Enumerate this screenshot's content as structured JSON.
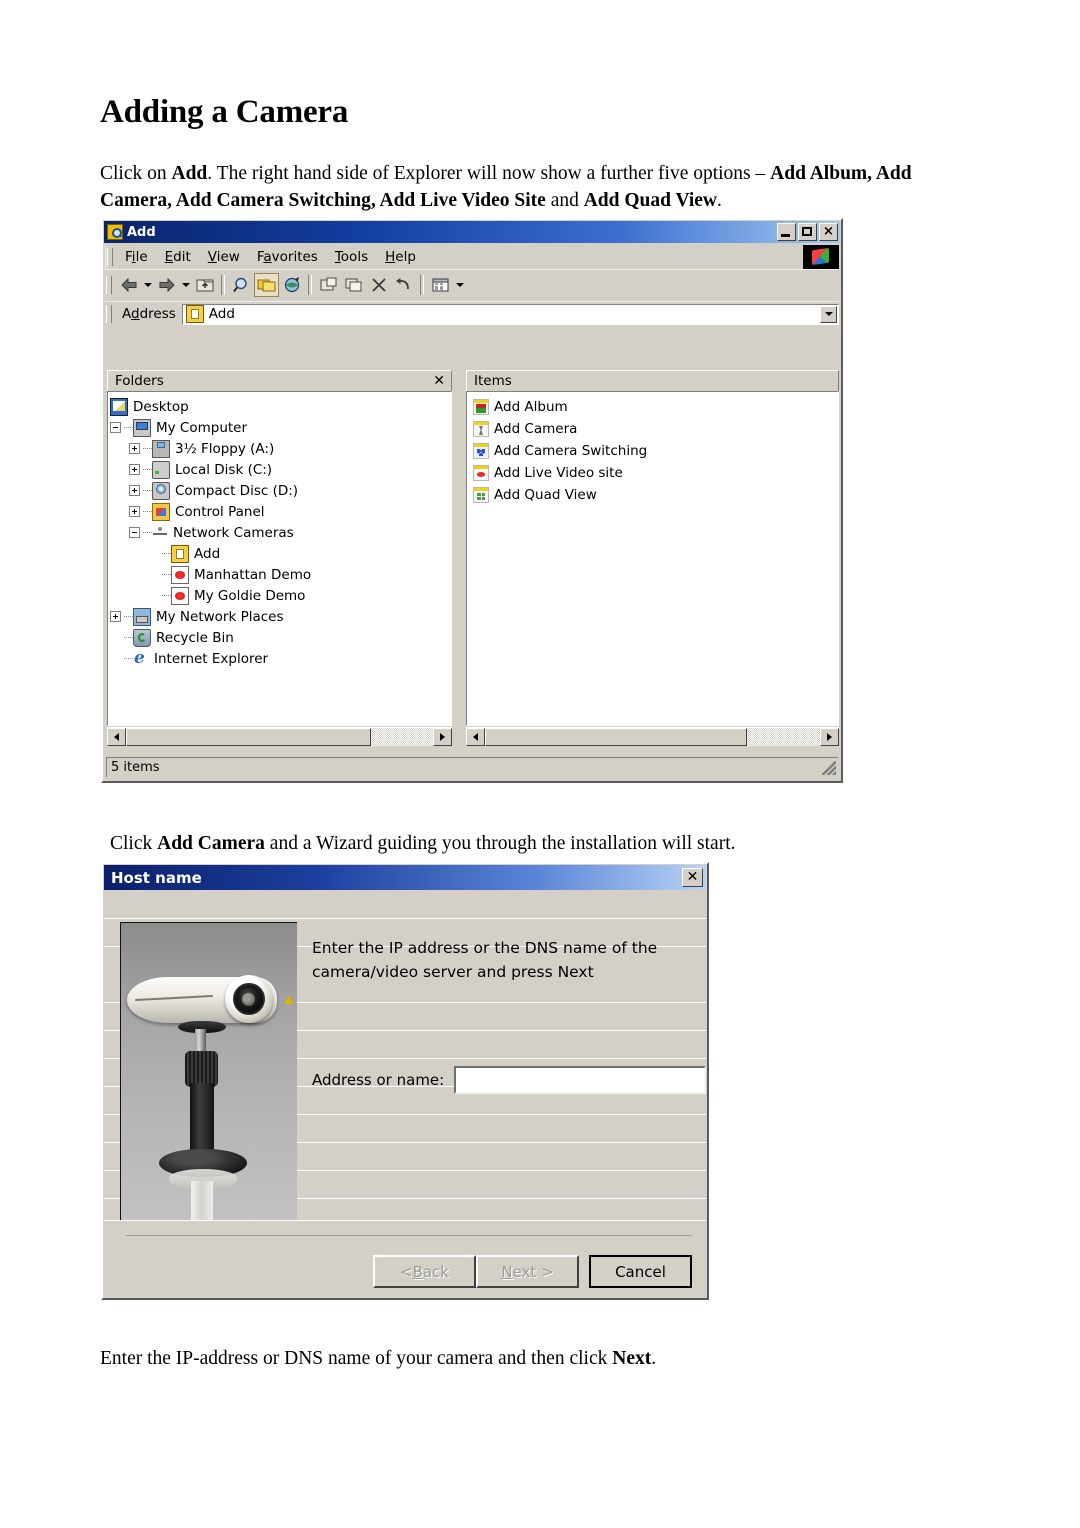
{
  "document": {
    "title": "Adding a Camera",
    "intro_para": [
      {
        "t": "Click on ",
        "b": false
      },
      {
        "t": "Add",
        "b": true
      },
      {
        "t": ". The right hand side of Explorer will now show a further five options – ",
        "b": false
      },
      {
        "t": "Add Album, Add Camera, Add Camera Switching, Add Live Video Site",
        "b": true
      },
      {
        "t": " and ",
        "b": false
      },
      {
        "t": "Add Quad View",
        "b": true
      },
      {
        "t": ".",
        "b": false
      }
    ],
    "mid_para": [
      {
        "t": "Click ",
        "b": false
      },
      {
        "t": "Add Camera",
        "b": true
      },
      {
        "t": " and a Wizard guiding you through the installation will start.",
        "b": false
      }
    ],
    "end_para": [
      {
        "t": "Enter the IP-address or DNS name of your camera and then click ",
        "b": false
      },
      {
        "t": "Next",
        "b": true
      },
      {
        "t": ".",
        "b": false
      }
    ]
  },
  "explorer": {
    "window_title": "Add",
    "title_icon": "search-folder-icon",
    "window_buttons": {
      "minimize": "minimize-icon",
      "maximize": "maximize-icon",
      "close": "×"
    },
    "menu": [
      {
        "pre": "F",
        "accel": "i",
        "post": "le",
        "label": "File"
      },
      {
        "pre": "",
        "accel": "E",
        "post": "dit",
        "label": "Edit"
      },
      {
        "pre": "",
        "accel": "V",
        "post": "iew",
        "label": "View"
      },
      {
        "pre": "F",
        "accel": "a",
        "post": "vorites",
        "label": "Favorites"
      },
      {
        "pre": "",
        "accel": "T",
        "post": "ools",
        "label": "Tools"
      },
      {
        "pre": "",
        "accel": "H",
        "post": "elp",
        "label": "Help"
      }
    ],
    "toolbar_buttons": [
      {
        "name": "back-button",
        "icon": "back-arrow-icon",
        "glyph": "⇦"
      },
      {
        "name": "back-dropdown",
        "icon": "chevron-down-icon",
        "glyph": ""
      },
      {
        "name": "forward-button",
        "icon": "forward-arrow-icon",
        "glyph": "⇨"
      },
      {
        "name": "forward-dropdown",
        "icon": "chevron-down-icon",
        "glyph": ""
      },
      {
        "name": "up-button",
        "icon": "up-folder-icon",
        "glyph": "⤒"
      },
      {
        "name": "search-button",
        "icon": "search-icon",
        "glyph": "⚲"
      },
      {
        "name": "folders-button",
        "icon": "folders-icon",
        "glyph": "▣"
      },
      {
        "name": "history-button",
        "icon": "history-globe-icon",
        "glyph": "◕"
      },
      {
        "name": "move-to-button",
        "icon": "move-to-folder-icon",
        "glyph": "❐"
      },
      {
        "name": "copy-to-button",
        "icon": "copy-to-folder-icon",
        "glyph": "❐"
      },
      {
        "name": "delete-button",
        "icon": "delete-x-icon",
        "glyph": "✕"
      },
      {
        "name": "undo-button",
        "icon": "undo-arrow-icon",
        "glyph": "↶"
      },
      {
        "name": "views-button",
        "icon": "views-icon",
        "glyph": "▦"
      }
    ],
    "address": {
      "label_pre": "A",
      "label_accel": "d",
      "label_post": "dress",
      "label": "Address",
      "value": "Add",
      "icon": "folder-add-icon"
    },
    "folders_pane": {
      "header": "Folders",
      "close": "✕",
      "tree": [
        {
          "label": "Desktop",
          "indent": 0,
          "expander": "none",
          "icon": "ico-desktop",
          "icon_name": "desktop-icon"
        },
        {
          "label": "My Computer",
          "indent": 1,
          "expander": "minus",
          "icon": "ico-computer",
          "icon_name": "my-computer-icon"
        },
        {
          "label": "3½ Floppy (A:)",
          "indent": 2,
          "expander": "plus",
          "icon": "ico-floppy",
          "icon_name": "floppy-drive-icon"
        },
        {
          "label": "Local Disk (C:)",
          "indent": 2,
          "expander": "plus",
          "icon": "ico-disk",
          "icon_name": "hard-disk-icon"
        },
        {
          "label": "Compact Disc (D:)",
          "indent": 2,
          "expander": "plus",
          "icon": "ico-cd",
          "icon_name": "cd-drive-icon"
        },
        {
          "label": "Control Panel",
          "indent": 2,
          "expander": "plus",
          "icon": "ico-cpanel",
          "icon_name": "control-panel-icon"
        },
        {
          "label": "Network Cameras",
          "indent": 2,
          "expander": "minus",
          "icon": "ico-netcam",
          "icon_name": "network-cameras-icon"
        },
        {
          "label": "Add",
          "indent": 3,
          "expander": "none",
          "icon": "ico-addfolder",
          "icon_name": "add-folder-icon"
        },
        {
          "label": "Manhattan Demo",
          "indent": 3,
          "expander": "none",
          "icon": "ico-live",
          "icon_name": "live-video-icon"
        },
        {
          "label": "My Goldie Demo",
          "indent": 3,
          "expander": "none",
          "icon": "ico-live",
          "icon_name": "live-video-icon"
        },
        {
          "label": "My Network Places",
          "indent": 1,
          "expander": "plus",
          "icon": "ico-netplaces",
          "icon_name": "my-network-places-icon"
        },
        {
          "label": "Recycle Bin",
          "indent": 1,
          "expander": "none",
          "icon": "ico-recycle",
          "icon_name": "recycle-bin-icon"
        },
        {
          "label": "Internet Explorer",
          "indent": 1,
          "expander": "none",
          "icon": "ico-ie",
          "icon_name": "internet-explorer-icon"
        }
      ]
    },
    "items_pane": {
      "header": "Items",
      "items": [
        {
          "label": "Add Album",
          "glyph": "gl-album",
          "icon_name": "add-album-icon"
        },
        {
          "label": "Add Camera",
          "glyph": "gl-camera",
          "icon_name": "add-camera-icon"
        },
        {
          "label": "Add Camera Switching",
          "glyph": "gl-switch",
          "icon_name": "add-camera-switching-icon"
        },
        {
          "label": "Add Live Video site",
          "glyph": "gl-video",
          "icon_name": "add-live-video-site-icon"
        },
        {
          "label": "Add Quad View",
          "glyph": "gl-quad",
          "icon_name": "add-quad-view-icon"
        }
      ]
    },
    "status_bar": {
      "text": "5 items"
    }
  },
  "dialog": {
    "title": "Host name",
    "close_label": "✕",
    "image_alt": "network-camera-photo",
    "instruction": "Enter the IP address or the DNS name of the camera/video server and press Next",
    "field": {
      "label": "Address or name:",
      "value": "",
      "placeholder": ""
    },
    "buttons": [
      {
        "name": "back-button",
        "pre": "< ",
        "accel": "B",
        "post": "ack",
        "label": "< Back",
        "state": "disabled"
      },
      {
        "name": "next-button",
        "pre": "",
        "accel": "N",
        "post": "ext >",
        "label": "Next >",
        "state": "disabled"
      },
      {
        "name": "cancel-button",
        "pre": "",
        "accel": "",
        "post": "Cancel",
        "label": "Cancel",
        "state": "default"
      }
    ]
  },
  "colors": {
    "window_face": "#d4d0c8",
    "title_gradient_start": "#0a246a",
    "title_gradient_end": "#a6caf0",
    "text": "#000000",
    "disabled_text": "#9a9a94"
  }
}
